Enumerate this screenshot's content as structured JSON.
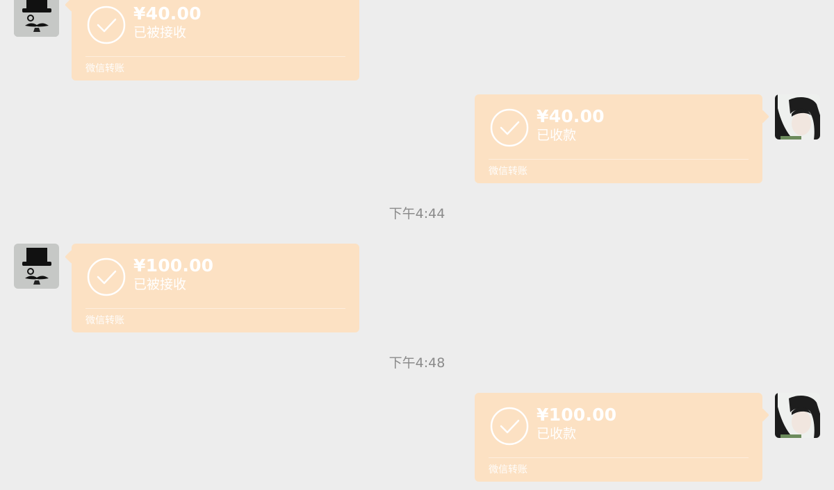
{
  "messages": [
    {
      "amount": "¥40.00",
      "status": "已被接收",
      "footer": "微信转账"
    },
    {
      "amount": "¥40.00",
      "status": "已收款",
      "footer": "微信转账"
    },
    {
      "amount": "¥100.00",
      "status": "已被接收",
      "footer": "微信转账"
    },
    {
      "amount": "¥100.00",
      "status": "已收款",
      "footer": "微信转账"
    }
  ],
  "timestamps": [
    "下午4:44",
    "下午4:48"
  ],
  "colors": {
    "background": "#ededed",
    "transfer_bubble": "#fce1c3",
    "timestamp_text": "#8a8a8a"
  }
}
